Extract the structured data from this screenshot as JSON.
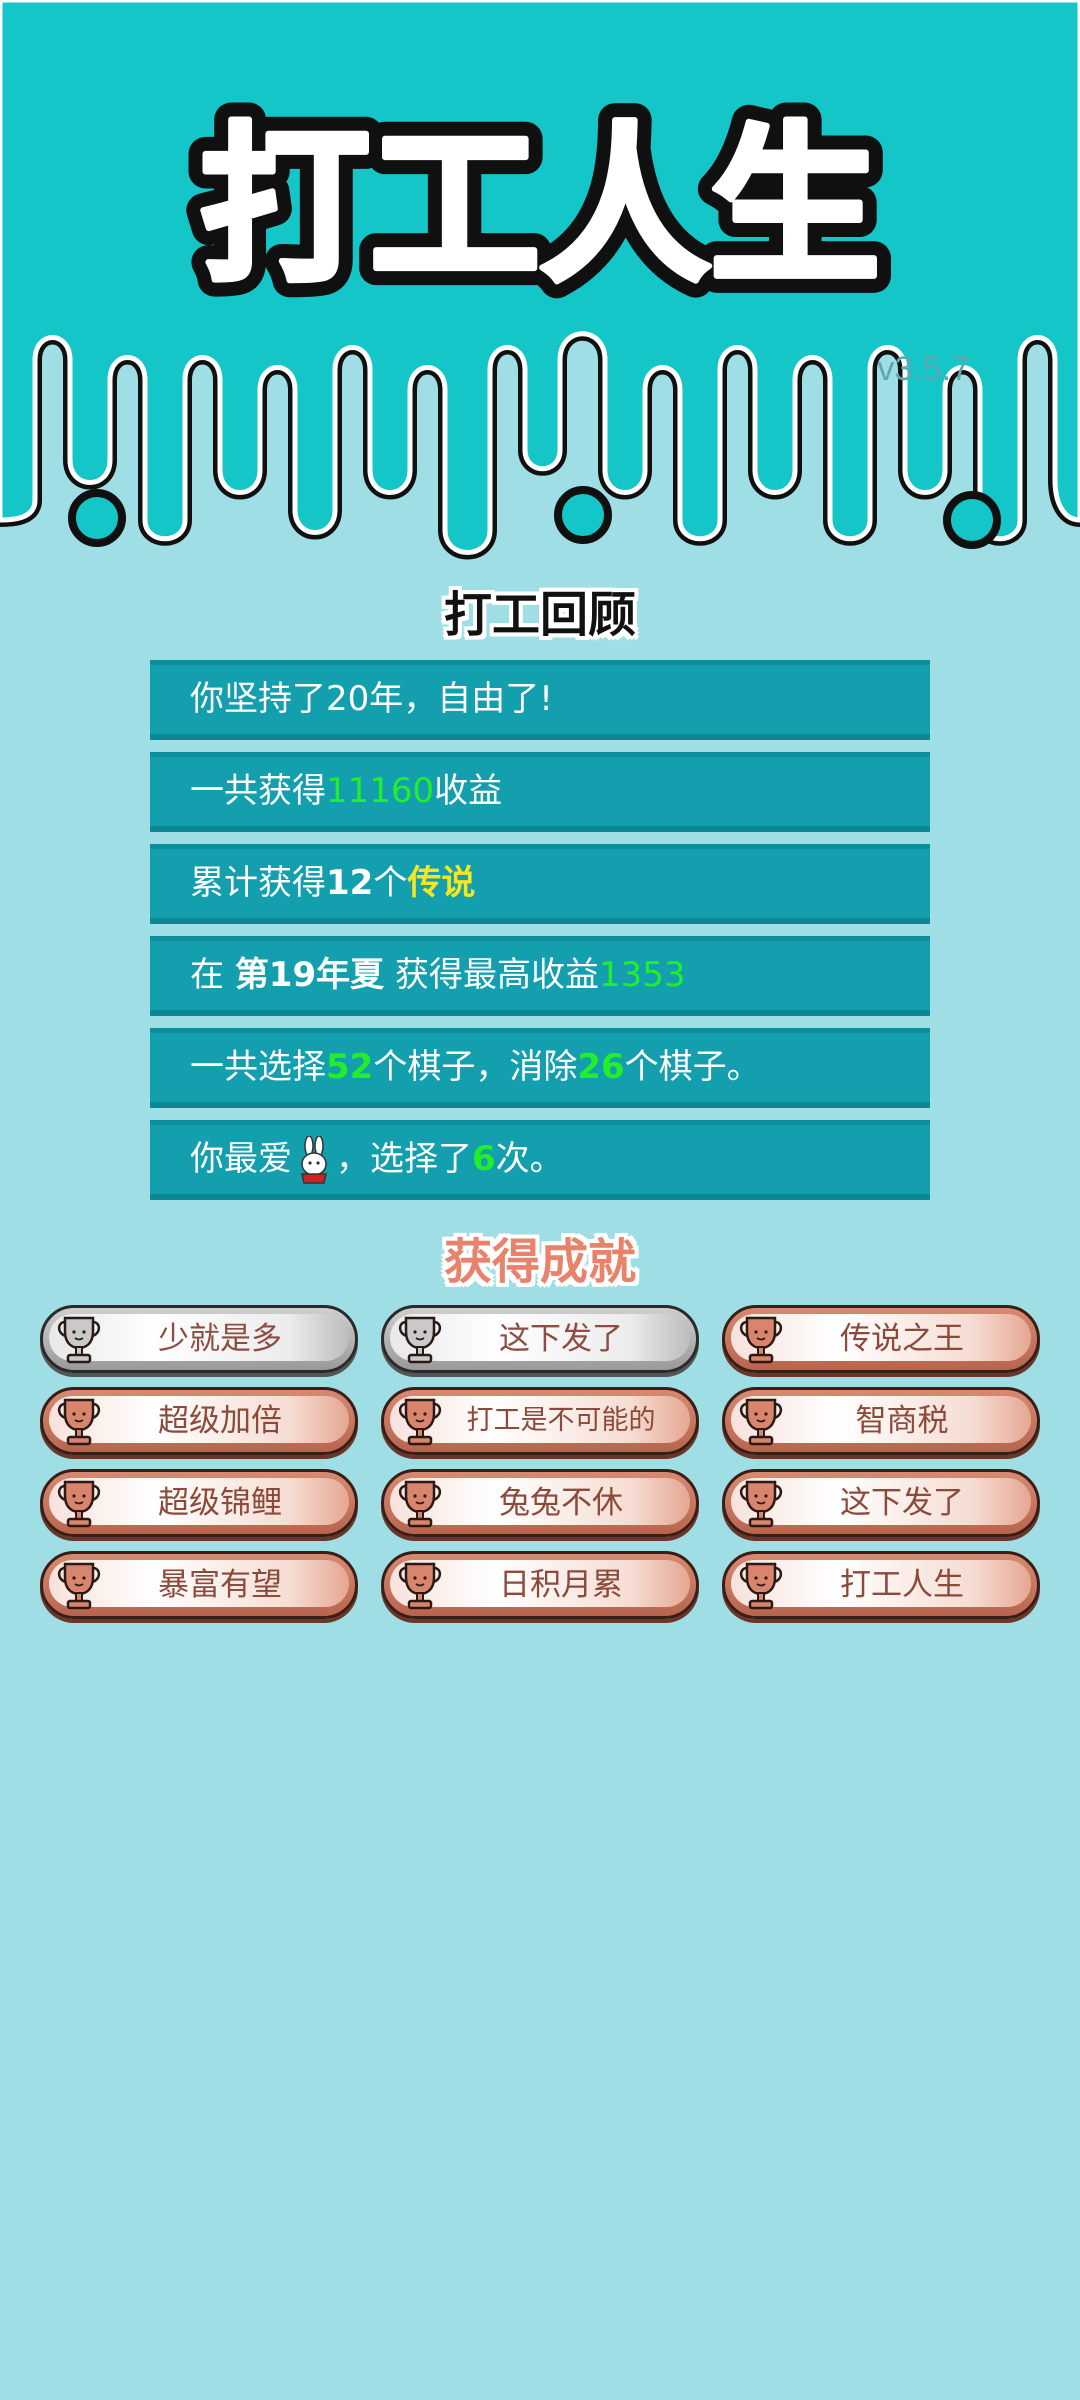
{
  "header": {
    "game_title": "打工人生",
    "version": "v3.5.7"
  },
  "review": {
    "title": "打工回顾",
    "rows": [
      {
        "prefix": "你坚持了20年，自由了!"
      },
      {
        "prefix": "一共获得",
        "value": "11160",
        "suffix": "收益"
      },
      {
        "prefix": "累计获得",
        "count": "12",
        "unit": "个",
        "highlight": "传说"
      },
      {
        "prefix": "在 ",
        "period": "第19年夏",
        "middle": " 获得最高收益",
        "value": "1353"
      },
      {
        "prefix": "一共选择",
        "value1": "52",
        "middle": "个棋子，消除",
        "value2": "26",
        "suffix": "个棋子。"
      },
      {
        "prefix": "你最爱",
        "icon": "bunny-icon",
        "middle": "，选择了",
        "value": "6",
        "suffix": "次。"
      }
    ]
  },
  "achievements": {
    "title": "获得成就",
    "items": [
      {
        "label": "少就是多",
        "tier": "silver"
      },
      {
        "label": "这下发了",
        "tier": "silver"
      },
      {
        "label": "传说之王",
        "tier": "bronze"
      },
      {
        "label": "超级加倍",
        "tier": "bronze"
      },
      {
        "label": "打工是不可能的",
        "tier": "bronze"
      },
      {
        "label": "智商税",
        "tier": "bronze"
      },
      {
        "label": "超级锦鲤",
        "tier": "bronze"
      },
      {
        "label": "兔兔不休",
        "tier": "bronze"
      },
      {
        "label": "这下发了",
        "tier": "bronze"
      },
      {
        "label": "暴富有望",
        "tier": "bronze"
      },
      {
        "label": "日积月累",
        "tier": "bronze"
      },
      {
        "label": "打工人生",
        "tier": "bronze"
      }
    ]
  },
  "colors": {
    "header_bg": "#15c6c8",
    "page_bg": "#a0dee5",
    "row_bg": "#139fad",
    "value_green": "#22ee2a",
    "legend_yellow": "#f5e622",
    "achievement_title": "#e8826a"
  }
}
